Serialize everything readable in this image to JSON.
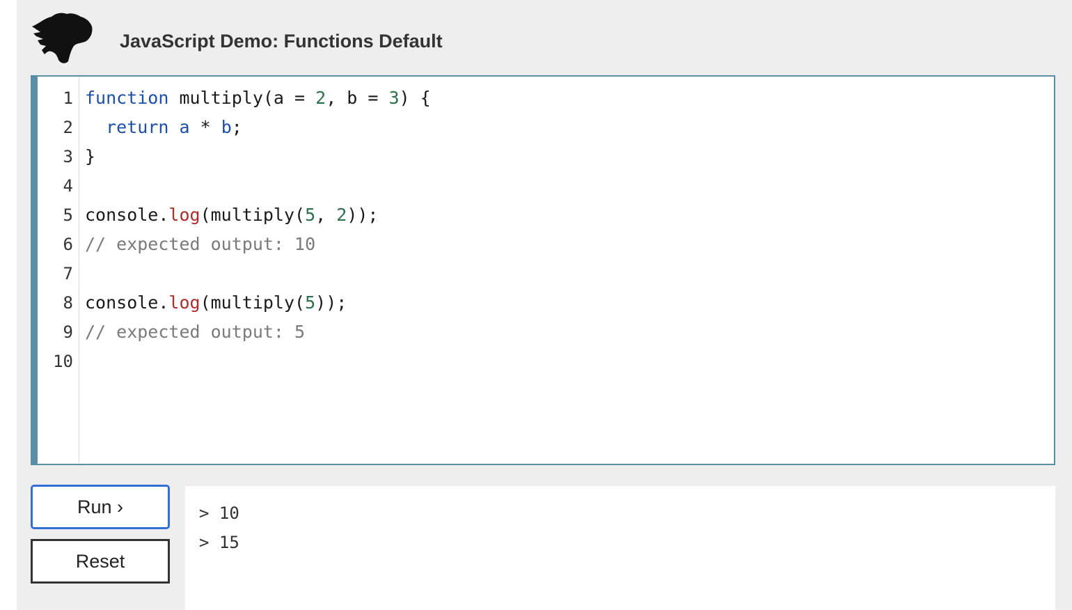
{
  "header": {
    "title": "JavaScript Demo: Functions Default",
    "logo_icon": "dinosaur-logo-icon"
  },
  "editor": {
    "accent_color": "#5a8ea8",
    "line_numbers": [
      "1",
      "2",
      "3",
      "4",
      "5",
      "6",
      "7",
      "8",
      "9",
      "10"
    ],
    "lines": [
      [
        {
          "t": "function",
          "c": "kw"
        },
        {
          "t": " multiply(a = ",
          "c": "pl"
        },
        {
          "t": "2",
          "c": "num"
        },
        {
          "t": ", b = ",
          "c": "pl"
        },
        {
          "t": "3",
          "c": "num"
        },
        {
          "t": ") {",
          "c": "pl"
        }
      ],
      [
        {
          "t": "  ",
          "c": "pl"
        },
        {
          "t": "return",
          "c": "kw"
        },
        {
          "t": " ",
          "c": "pl"
        },
        {
          "t": "a",
          "c": "kw"
        },
        {
          "t": " * ",
          "c": "pl"
        },
        {
          "t": "b",
          "c": "kw"
        },
        {
          "t": ";",
          "c": "pl"
        }
      ],
      [
        {
          "t": "}",
          "c": "pl"
        }
      ],
      [],
      [
        {
          "t": "console.",
          "c": "pl"
        },
        {
          "t": "log",
          "c": "fn"
        },
        {
          "t": "(multiply(",
          "c": "pl"
        },
        {
          "t": "5",
          "c": "num"
        },
        {
          "t": ", ",
          "c": "pl"
        },
        {
          "t": "2",
          "c": "num"
        },
        {
          "t": "));",
          "c": "pl"
        }
      ],
      [
        {
          "t": "// expected output: 10",
          "c": "cm"
        }
      ],
      [],
      [
        {
          "t": "console.",
          "c": "pl"
        },
        {
          "t": "log",
          "c": "fn"
        },
        {
          "t": "(multiply(",
          "c": "pl"
        },
        {
          "t": "5",
          "c": "num"
        },
        {
          "t": "));",
          "c": "pl"
        }
      ],
      [
        {
          "t": "// expected output: 5",
          "c": "cm"
        }
      ],
      []
    ]
  },
  "buttons": {
    "run_label": "Run ›",
    "reset_label": "Reset",
    "run_color": "#2f6fd6"
  },
  "console": {
    "lines": [
      "> 10",
      "> 15"
    ]
  }
}
